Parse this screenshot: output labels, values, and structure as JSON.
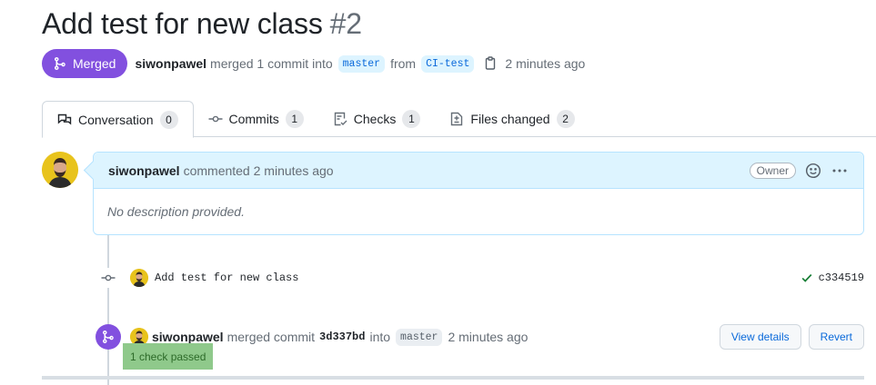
{
  "pr": {
    "title": "Add test for new class",
    "number": "#2",
    "state": "Merged",
    "author": "siwonpawel",
    "merge_text": "merged 1 commit into",
    "base_branch": "master",
    "from_text": "from",
    "head_branch": "CI-test",
    "time": "2 minutes ago"
  },
  "tabs": [
    {
      "label": "Conversation",
      "count": "0",
      "icon": "comment-discussion-icon"
    },
    {
      "label": "Commits",
      "count": "1",
      "icon": "git-commit-icon"
    },
    {
      "label": "Checks",
      "count": "1",
      "icon": "checklist-icon"
    },
    {
      "label": "Files changed",
      "count": "2",
      "icon": "file-diff-icon"
    }
  ],
  "comment": {
    "author": "siwonpawel",
    "action": "commented",
    "time": "2 minutes ago",
    "badge": "Owner",
    "body": "No description provided."
  },
  "commit": {
    "message": "Add test for new class",
    "sha": "c334519",
    "status_color": "#1a7f37"
  },
  "merge_event": {
    "author": "siwonpawel",
    "action": "merged commit",
    "sha": "3d337bd",
    "into": "into",
    "branch": "master",
    "time": "2 minutes ago",
    "view_details": "View details",
    "revert": "Revert",
    "checks": "1 check passed"
  },
  "colors": {
    "merged": "#8250df",
    "link": "#0969da",
    "success": "#1a7f37"
  }
}
